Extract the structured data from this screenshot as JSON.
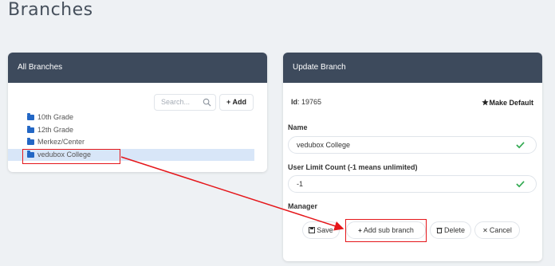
{
  "page": {
    "title": "Branches"
  },
  "left_panel": {
    "header": "All Branches",
    "search": {
      "placeholder": "Search..."
    },
    "add_label": "Add",
    "tree": [
      {
        "label": "10th Grade",
        "selected": false
      },
      {
        "label": "12th Grade",
        "selected": false
      },
      {
        "label": "Merkez/Center",
        "selected": false
      },
      {
        "label": "vedubox College",
        "selected": true
      }
    ]
  },
  "right_panel": {
    "header": "Update Branch",
    "id_label": "Id",
    "id_value": ": 19765",
    "make_default_label": "Make Default",
    "name_label": "Name",
    "name_value": "vedubox College",
    "user_limit_label": "User Limit Count (-1 means unlimited)",
    "user_limit_value": "-1",
    "manager_label": "Manager",
    "buttons": {
      "save": "Save",
      "add_sub_branch": "Add sub branch",
      "delete": "Delete",
      "cancel": "Cancel"
    }
  },
  "colors": {
    "header_bg": "#3d4a5c",
    "accent": "#2367c5",
    "highlight": "#e5161a",
    "check": "#2fa84f"
  },
  "icons": [
    "search-icon",
    "plus-icon",
    "folder-icon",
    "star-icon",
    "check-icon",
    "save-icon",
    "trash-icon",
    "close-icon"
  ]
}
